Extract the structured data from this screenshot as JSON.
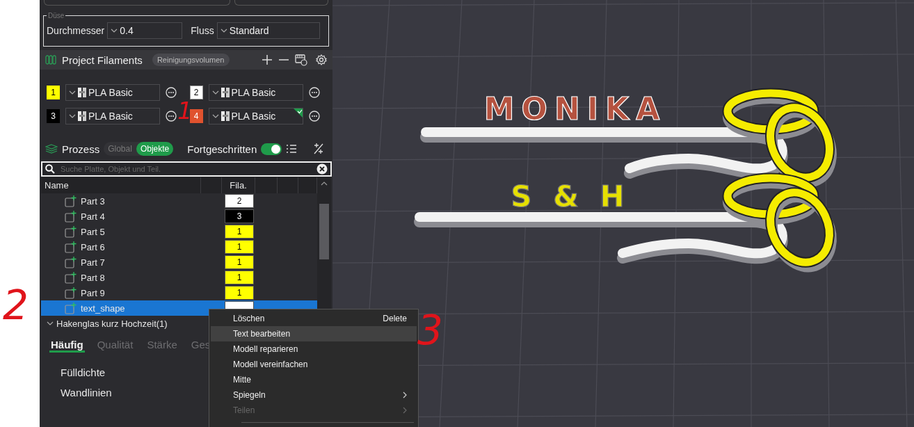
{
  "nozzle": {
    "legend": "Düse",
    "diameter_label": "Durchmesser",
    "diameter_value": "0.4",
    "flow_label": "Fluss",
    "flow_value": "Standard"
  },
  "filaments_panel": {
    "title": "Project Filaments",
    "purge_button": "Reinigungsvolumen",
    "slots": [
      {
        "number": "1",
        "color": "#ffff00",
        "material": "PLA Basic",
        "synced": false
      },
      {
        "number": "2",
        "color": "#ffffff",
        "material": "PLA Basic",
        "synced": false
      },
      {
        "number": "3",
        "color": "#000000",
        "material": "PLA Basic",
        "synced": false
      },
      {
        "number": "4",
        "color": "#e0522e",
        "material": "PLA Basic",
        "synced": true
      }
    ]
  },
  "process": {
    "title": "Prozess",
    "scope_tabs": [
      {
        "label": "Global",
        "selected": false
      },
      {
        "label": "Objekte",
        "selected": true
      }
    ],
    "advanced_label": "Fortgeschritten",
    "advanced_on": true
  },
  "search": {
    "placeholder": "Suche Platte, Objekt und Teil."
  },
  "object_list": {
    "columns": [
      "Name",
      "Fila."
    ],
    "rows": [
      {
        "kind": "part",
        "name": "Part 3",
        "filament": "2",
        "color": "#ffffff",
        "selected": false
      },
      {
        "kind": "part",
        "name": "Part 4",
        "filament": "3",
        "color": "#000000",
        "selected": false
      },
      {
        "kind": "part",
        "name": "Part 5",
        "filament": "1",
        "color": "#ffff00",
        "selected": false
      },
      {
        "kind": "part",
        "name": "Part 6",
        "filament": "1",
        "color": "#ffff00",
        "selected": false
      },
      {
        "kind": "part",
        "name": "Part 7",
        "filament": "1",
        "color": "#ffff00",
        "selected": false
      },
      {
        "kind": "part",
        "name": "Part 8",
        "filament": "1",
        "color": "#ffff00",
        "selected": false
      },
      {
        "kind": "part",
        "name": "Part 9",
        "filament": "1",
        "color": "#ffff00",
        "selected": false
      },
      {
        "kind": "part",
        "name": "text_shape",
        "color": "#ffffff",
        "selected": true
      },
      {
        "kind": "object",
        "name": "Hakenglas kurz Hochzeit(1)",
        "expanded": true,
        "selected": false
      }
    ]
  },
  "settings_tabs": [
    {
      "label": "Häufig",
      "selected": true
    },
    {
      "label": "Qualität",
      "selected": false
    },
    {
      "label": "Stärke",
      "selected": false
    },
    {
      "label": "Ges",
      "selected": false
    }
  ],
  "settings_items": [
    "Fülldichte",
    "Wandlinien"
  ],
  "context_menu": {
    "items": [
      {
        "label": "Löschen",
        "shortcut": "Delete",
        "hovered": false,
        "disabled": false,
        "submenu": false
      },
      {
        "label": "Text bearbeiten",
        "hovered": true,
        "disabled": false,
        "submenu": false
      },
      {
        "label": "Modell reparieren",
        "hovered": false,
        "disabled": false,
        "submenu": false
      },
      {
        "label": "Modell vereinfachen",
        "hovered": false,
        "disabled": false,
        "submenu": false
      },
      {
        "label": "Mitte",
        "hovered": false,
        "disabled": false,
        "submenu": false
      },
      {
        "label": "Spiegeln",
        "hovered": false,
        "disabled": false,
        "submenu": true
      },
      {
        "label": "Teilen",
        "hovered": false,
        "disabled": true,
        "submenu": true
      }
    ]
  },
  "scene": {
    "labels": [
      {
        "text": "MONIKA",
        "color": "#b5523f"
      },
      {
        "text": "S & H",
        "color": "#e6e000"
      }
    ]
  },
  "annotations": [
    "1",
    "2",
    "3"
  ]
}
